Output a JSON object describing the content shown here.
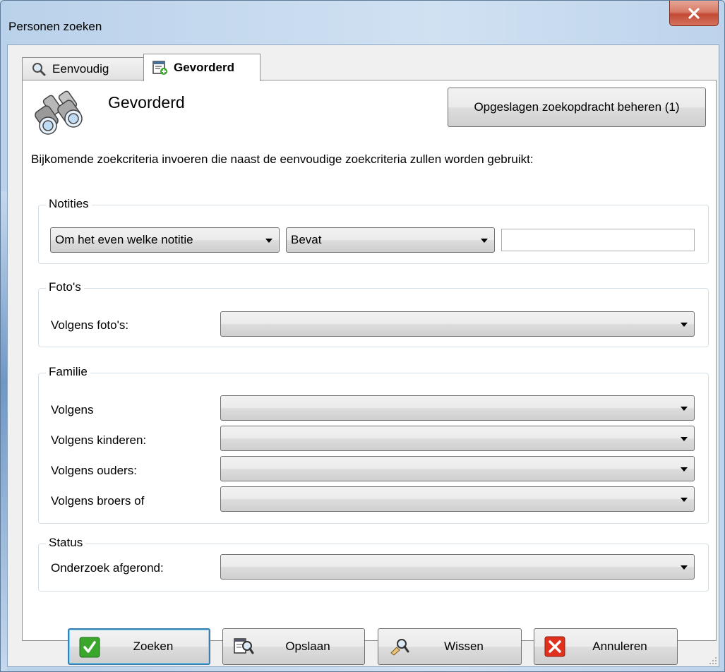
{
  "window": {
    "title": "Personen zoeken"
  },
  "tabs": [
    {
      "label": "Eenvoudig",
      "icon": "search-icon"
    },
    {
      "label": "Gevorderd",
      "icon": "advanced-search-icon"
    }
  ],
  "panel": {
    "title": "Gevorderd",
    "saved_searches_button": "Opgeslagen zoekopdracht beheren (1)",
    "description": "Bijkomende zoekcriteria invoeren die naast de eenvoudige zoekcriteria zullen worden gebruikt:"
  },
  "notes": {
    "legend": "Notities",
    "note_type_selected": "Om het even welke notitie",
    "operator_selected": "Bevat",
    "value": ""
  },
  "photos": {
    "legend": "Foto's",
    "label": "Volgens foto's:",
    "selected": ""
  },
  "family": {
    "legend": "Familie",
    "rows": [
      {
        "label": "Volgens",
        "selected": ""
      },
      {
        "label": "Volgens kinderen:",
        "selected": ""
      },
      {
        "label": "Volgens ouders:",
        "selected": ""
      },
      {
        "label": "Volgens broers of",
        "selected": ""
      }
    ]
  },
  "status": {
    "legend": "Status",
    "label": "Onderzoek afgerond:",
    "selected": ""
  },
  "buttons": {
    "search": "Zoeken",
    "save": "Opslaan",
    "clear": "Wissen",
    "cancel": "Annuleren"
  },
  "colors": {
    "accent_blue": "#3c7fb1",
    "check_green": "#3aa62c",
    "cancel_red": "#e0301e"
  }
}
